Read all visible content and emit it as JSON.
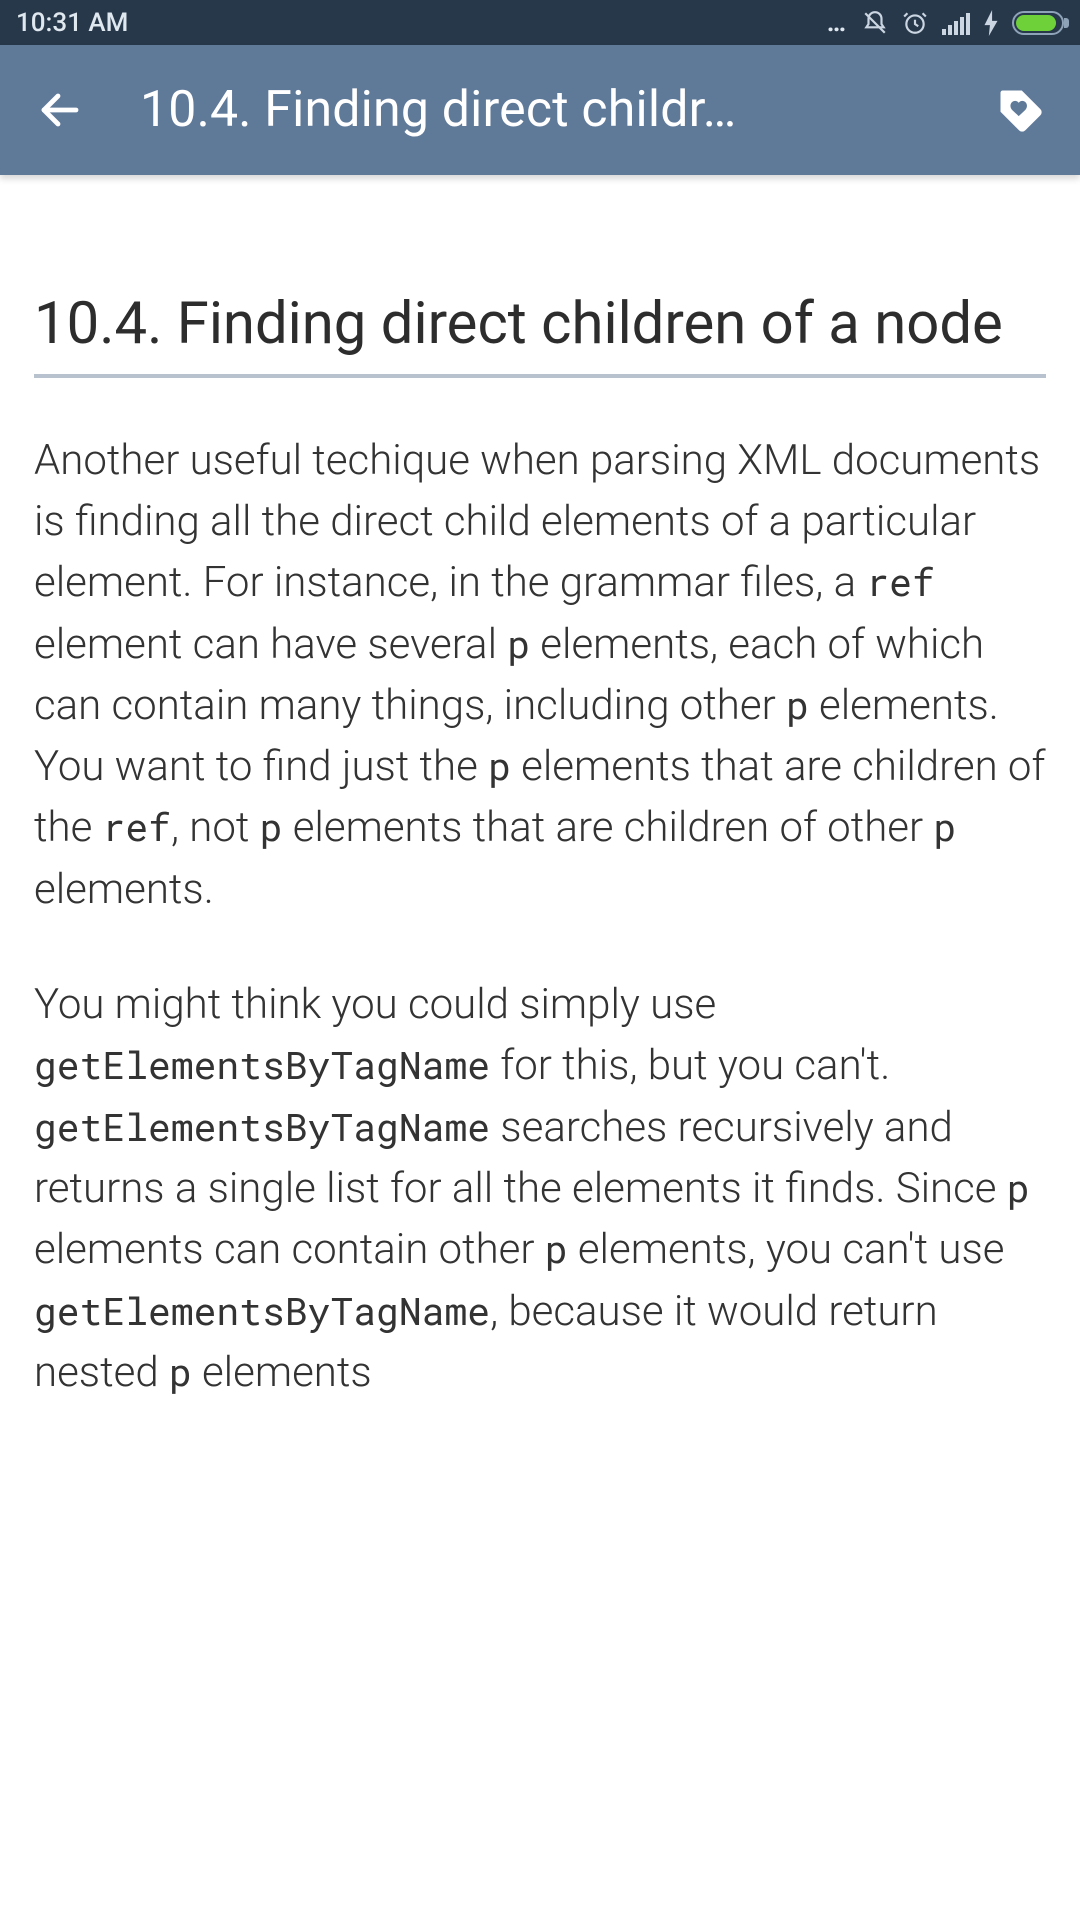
{
  "status": {
    "time": "10:31 AM"
  },
  "appbar": {
    "title": "10.4. Finding direct childr…"
  },
  "article": {
    "heading": "10.4. Finding direct children of a node",
    "p1": {
      "s1": "Another useful techique when parsing XML documents is finding all the direct child elements of a particular element. For instance, in the grammar files, a ",
      "c1": "ref",
      "s2": " element can have several ",
      "c2": "p",
      "s3": " elements, each of which can contain many things, including other ",
      "c3": "p",
      "s4": " elements. You want to find just the ",
      "c4": "p",
      "s5": " elements that are children of the ",
      "c5": "ref",
      "s6": ", not ",
      "c6": "p",
      "s7": " elements that are children of other ",
      "c7": "p",
      "s8": " elements."
    },
    "p2": {
      "s1": "You might think you could simply use ",
      "c1": "getElementsByTagName",
      "s2": " for this, but you can't. ",
      "c2": "getElementsByTagName",
      "s3": " searches recursively and returns a single list for all the elements it finds. Since ",
      "c3": "p",
      "s4": " elements can contain other ",
      "c4": "p",
      "s5": " elements, you can't use ",
      "c5": "getElementsByTagName",
      "s6": ", because it would return nested ",
      "c6": "p",
      "s7": " elements"
    }
  }
}
